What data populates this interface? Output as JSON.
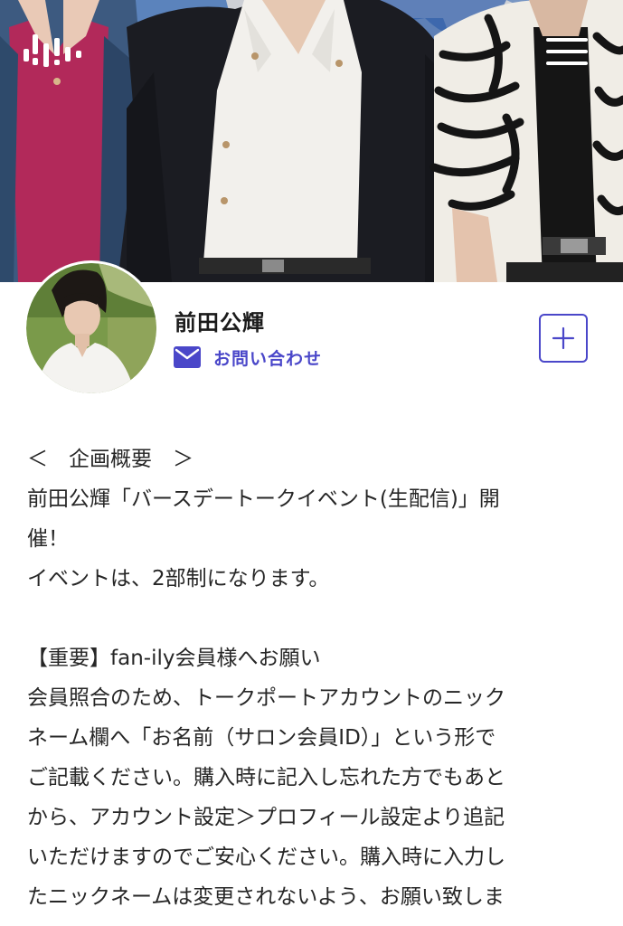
{
  "header": {
    "logo_icon": "fanily-logo-icon",
    "menu_icon": "hamburger-menu-icon"
  },
  "profile": {
    "name": "前田公輝",
    "contact_label": "お問い合わせ",
    "contact_icon": "mail-icon",
    "follow_icon": "plus-icon",
    "accent_color": "#4a47c9"
  },
  "post": {
    "lines": [
      "＜　企画概要　＞",
      "前田公輝「バースデートークイベント(生配信)」開",
      "催！",
      "イベントは、2部制になります。",
      "",
      "【重要】fan-ily会員様へお願い",
      "会員照合のため、トークポートアカウントのニック",
      "ネーム欄へ「お名前（サロン会員ID）」という形で",
      "ご記載ください。購入時に記入し忘れた方でもあと",
      "から、アカウント設定＞プロフィール設定より追記",
      "いただけますのでご安心ください。購入時に入力し",
      "たニックネームは変更されないよう、お願い致しま"
    ]
  }
}
